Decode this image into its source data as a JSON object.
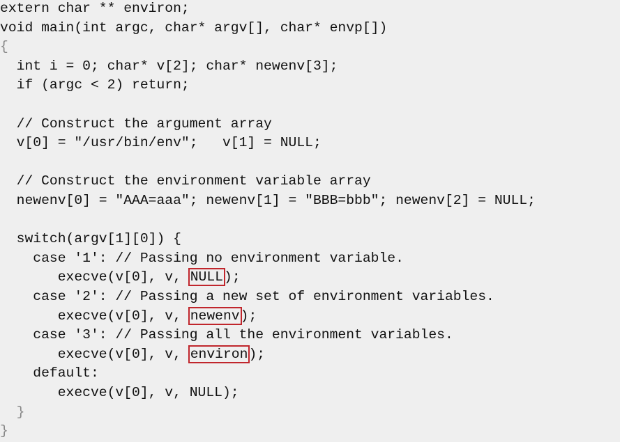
{
  "accent": {
    "box_color": "#c0262c",
    "text_color": "#111111",
    "background": "#efefef"
  },
  "code": {
    "lines": [
      {
        "segments": [
          {
            "text": "extern char ** environ;"
          }
        ]
      },
      {
        "segments": [
          {
            "text": "void main(int argc, char* argv[], char* envp[])"
          }
        ]
      },
      {
        "segments": [
          {
            "text": "{",
            "muted": true
          }
        ]
      },
      {
        "segments": [
          {
            "text": "  int i = 0; char* v[2]; char* newenv[3];"
          }
        ]
      },
      {
        "segments": [
          {
            "text": "  if (argc < 2) return;"
          }
        ]
      },
      {
        "segments": [
          {
            "text": ""
          }
        ]
      },
      {
        "segments": [
          {
            "text": "  // Construct the argument array"
          }
        ]
      },
      {
        "segments": [
          {
            "text": "  v[0] = \"/usr/bin/env\";   v[1] = NULL;"
          }
        ]
      },
      {
        "segments": [
          {
            "text": ""
          }
        ]
      },
      {
        "segments": [
          {
            "text": "  // Construct the environment variable array"
          }
        ]
      },
      {
        "segments": [
          {
            "text": "  newenv[0] = \"AAA=aaa\"; newenv[1] = \"BBB=bbb\"; newenv[2] = NULL;"
          }
        ]
      },
      {
        "segments": [
          {
            "text": ""
          }
        ]
      },
      {
        "segments": [
          {
            "text": "  switch(argv[1][0]) {"
          }
        ]
      },
      {
        "segments": [
          {
            "text": "    case '1': // Passing no environment variable."
          }
        ]
      },
      {
        "segments": [
          {
            "text": "       execve(v[0], v, "
          },
          {
            "text": "NULL",
            "boxed": true
          },
          {
            "text": ");"
          }
        ]
      },
      {
        "segments": [
          {
            "text": "    case '2': // Passing a new set of environment variables."
          }
        ]
      },
      {
        "segments": [
          {
            "text": "       execve(v[0], v, "
          },
          {
            "text": "newenv",
            "boxed": true
          },
          {
            "text": ");"
          }
        ]
      },
      {
        "segments": [
          {
            "text": "    case '3': // Passing all the environment variables."
          }
        ]
      },
      {
        "segments": [
          {
            "text": "       execve(v[0], v, "
          },
          {
            "text": "environ",
            "boxed": true
          },
          {
            "text": ");"
          }
        ]
      },
      {
        "segments": [
          {
            "text": "    default:"
          }
        ]
      },
      {
        "segments": [
          {
            "text": "       execve(v[0], v, NULL);"
          }
        ]
      },
      {
        "segments": [
          {
            "text": "  }",
            "muted": true
          }
        ]
      },
      {
        "segments": [
          {
            "text": "}",
            "muted": true
          }
        ]
      }
    ]
  }
}
